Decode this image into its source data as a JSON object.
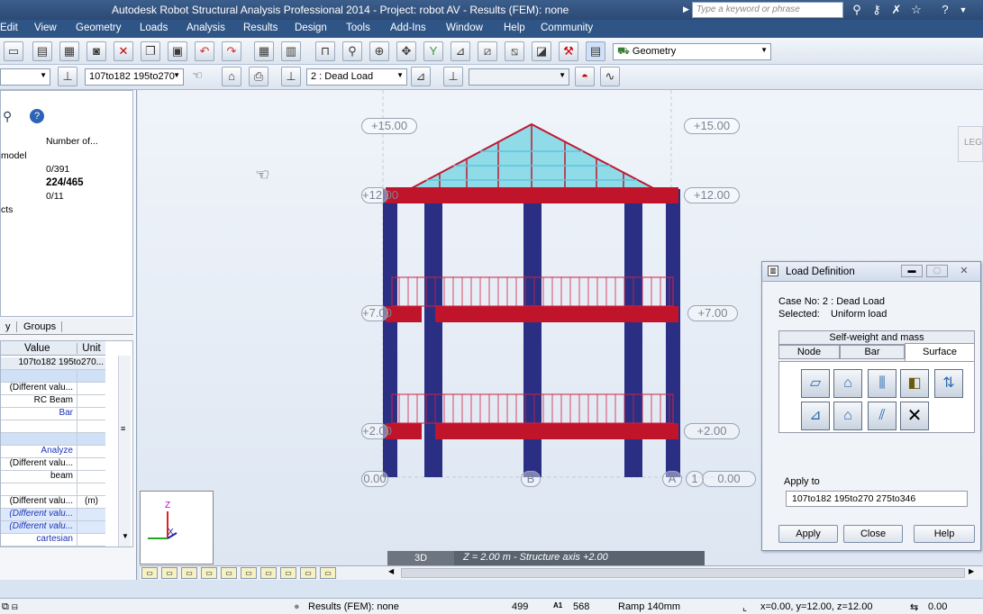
{
  "window": {
    "title": "Autodesk Robot Structural Analysis Professional 2014 - Project: robot AV - Results (FEM): none"
  },
  "search": {
    "placeholder": "Type a keyword or phrase"
  },
  "menu": [
    "Edit",
    "View",
    "Geometry",
    "Loads",
    "Analysis",
    "Results",
    "Design",
    "Tools",
    "Add-Ins",
    "Window",
    "Help",
    "Community"
  ],
  "toolbar": {
    "layout_combo": "Geometry",
    "selection_combo": "107to182 195to270",
    "case_combo": "2 : Dead Load"
  },
  "left_panel": {
    "header_number": "Number of...",
    "rows": [
      {
        "label": "model",
        "value": ""
      },
      {
        "label": "",
        "value": "0/391"
      },
      {
        "label": "",
        "value": "224/465"
      },
      {
        "label": "",
        "value": "0/11"
      },
      {
        "label": "cts",
        "value": ""
      }
    ],
    "tabs": [
      "y",
      "Groups"
    ],
    "grid_headers": {
      "value": "Value",
      "unit": "Unit"
    },
    "grid_rows": [
      {
        "value": "107to182 195to270...",
        "unit": "",
        "style": "head"
      },
      {
        "value": "",
        "unit": "",
        "style": "sect"
      },
      {
        "value": "(Different valu...",
        "unit": "",
        "style": ""
      },
      {
        "value": "RC Beam",
        "unit": "",
        "style": ""
      },
      {
        "value": "Bar",
        "unit": "",
        "style": "blue"
      },
      {
        "value": "",
        "unit": "",
        "style": ""
      },
      {
        "value": "",
        "unit": "",
        "style": "sect"
      },
      {
        "value": "Analyze",
        "unit": "",
        "style": "blue"
      },
      {
        "value": "(Different valu...",
        "unit": "",
        "style": ""
      },
      {
        "value": "beam",
        "unit": "",
        "style": ""
      },
      {
        "value": "",
        "unit": "",
        "style": ""
      },
      {
        "value": "(Different valu...",
        "unit": "(m)",
        "style": ""
      },
      {
        "value": "(Different valu...",
        "unit": "",
        "style": "sel"
      },
      {
        "value": "(Different valu...",
        "unit": "",
        "style": "sel"
      },
      {
        "value": "cartesian",
        "unit": "",
        "style": "blue"
      }
    ]
  },
  "viewport": {
    "levels_left": [
      "+15.00",
      "+12.00",
      "+7.00",
      "+2.00",
      "0.00"
    ],
    "levels_right": [
      "+15.00",
      "+12.00",
      "+7.00",
      "+2.00",
      "0.00"
    ],
    "grid_labels": [
      "B",
      "A",
      "1"
    ],
    "axis": {
      "z": "Z",
      "x": "X"
    },
    "view_tab": "3D",
    "plane_info": "Z = 2.00 m - Structure axis +2.00",
    "legend_btn": "LEG"
  },
  "dialog": {
    "title": "Load Definition",
    "case_label": "Case No: 2 : Dead Load",
    "selected_label": "Selected:",
    "selected_value": "Uniform load",
    "tab_top": "Self-weight and mass",
    "tabs": [
      "Node",
      "Bar",
      "Surface"
    ],
    "apply_to_label": "Apply to",
    "apply_to_value": "107to182 195to270 275to346",
    "buttons": {
      "apply": "Apply",
      "close": "Close",
      "help": "Help"
    }
  },
  "status": {
    "results": "Results (FEM): none",
    "num1": "499",
    "num2": "568",
    "section": "Ramp 140mm",
    "coords": "x=0.00, y=12.00, z=12.00",
    "angle": "0.00"
  },
  "colors": {
    "column": "#2b2f84",
    "beam": "#c0142a",
    "roof": "#7fd6e6",
    "menu": "#2f5587"
  }
}
